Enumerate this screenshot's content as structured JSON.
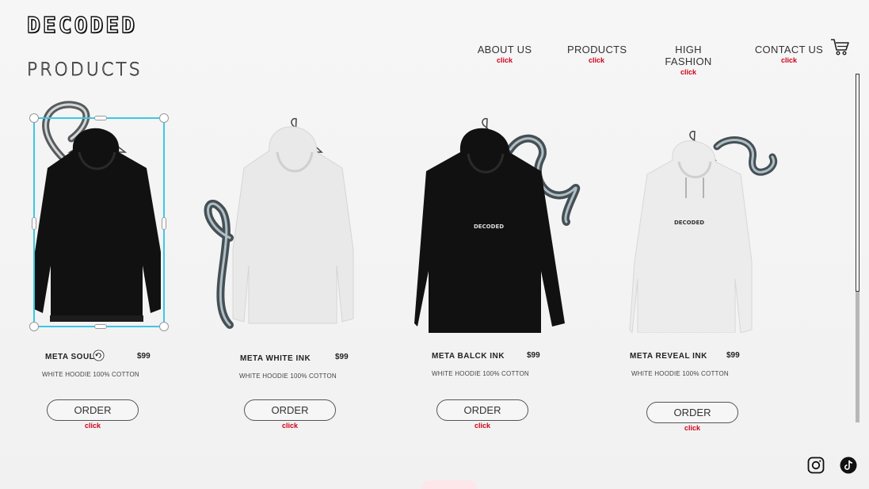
{
  "brand": {
    "logo": "DECODED"
  },
  "page": {
    "title": "PRODUCTS"
  },
  "nav": [
    {
      "label": "ABOUT US",
      "hint": "click"
    },
    {
      "label": "PRODUCTS",
      "hint": "click"
    },
    {
      "label": "HIGH FASHION",
      "hint": "click"
    },
    {
      "label": "CONTACT US",
      "hint": "click"
    }
  ],
  "icons": {
    "cart": "cart-icon",
    "instagram": "instagram-icon",
    "tiktok": "tiktok-icon",
    "rotate": "rotate-icon"
  },
  "colors": {
    "accent_hint": "#d0021b",
    "selection": "#3bc8e6"
  },
  "products": [
    {
      "name": "META SOUL C",
      "price": "$99",
      "desc": "WHITE HOODIE 100% COTTON",
      "order": "ORDER",
      "hint": "click",
      "hoodie_color": "black",
      "print": ""
    },
    {
      "name": "META WHITE INK",
      "price": "$99",
      "desc": "WHITE HOODIE 100% COTTON",
      "order": "ORDER",
      "hint": "click",
      "hoodie_color": "white",
      "print": ""
    },
    {
      "name": "META BALCK INK",
      "price": "$99",
      "desc": "WHITE HOODIE 100% COTTON",
      "order": "ORDER",
      "hint": "click",
      "hoodie_color": "black",
      "print": "DECODED"
    },
    {
      "name": "META REVEAL INK",
      "price": "$99",
      "desc": "WHITE HOODIE 100% COTTON",
      "order": "ORDER",
      "hint": "click",
      "hoodie_color": "white",
      "print": "DECODED"
    }
  ]
}
